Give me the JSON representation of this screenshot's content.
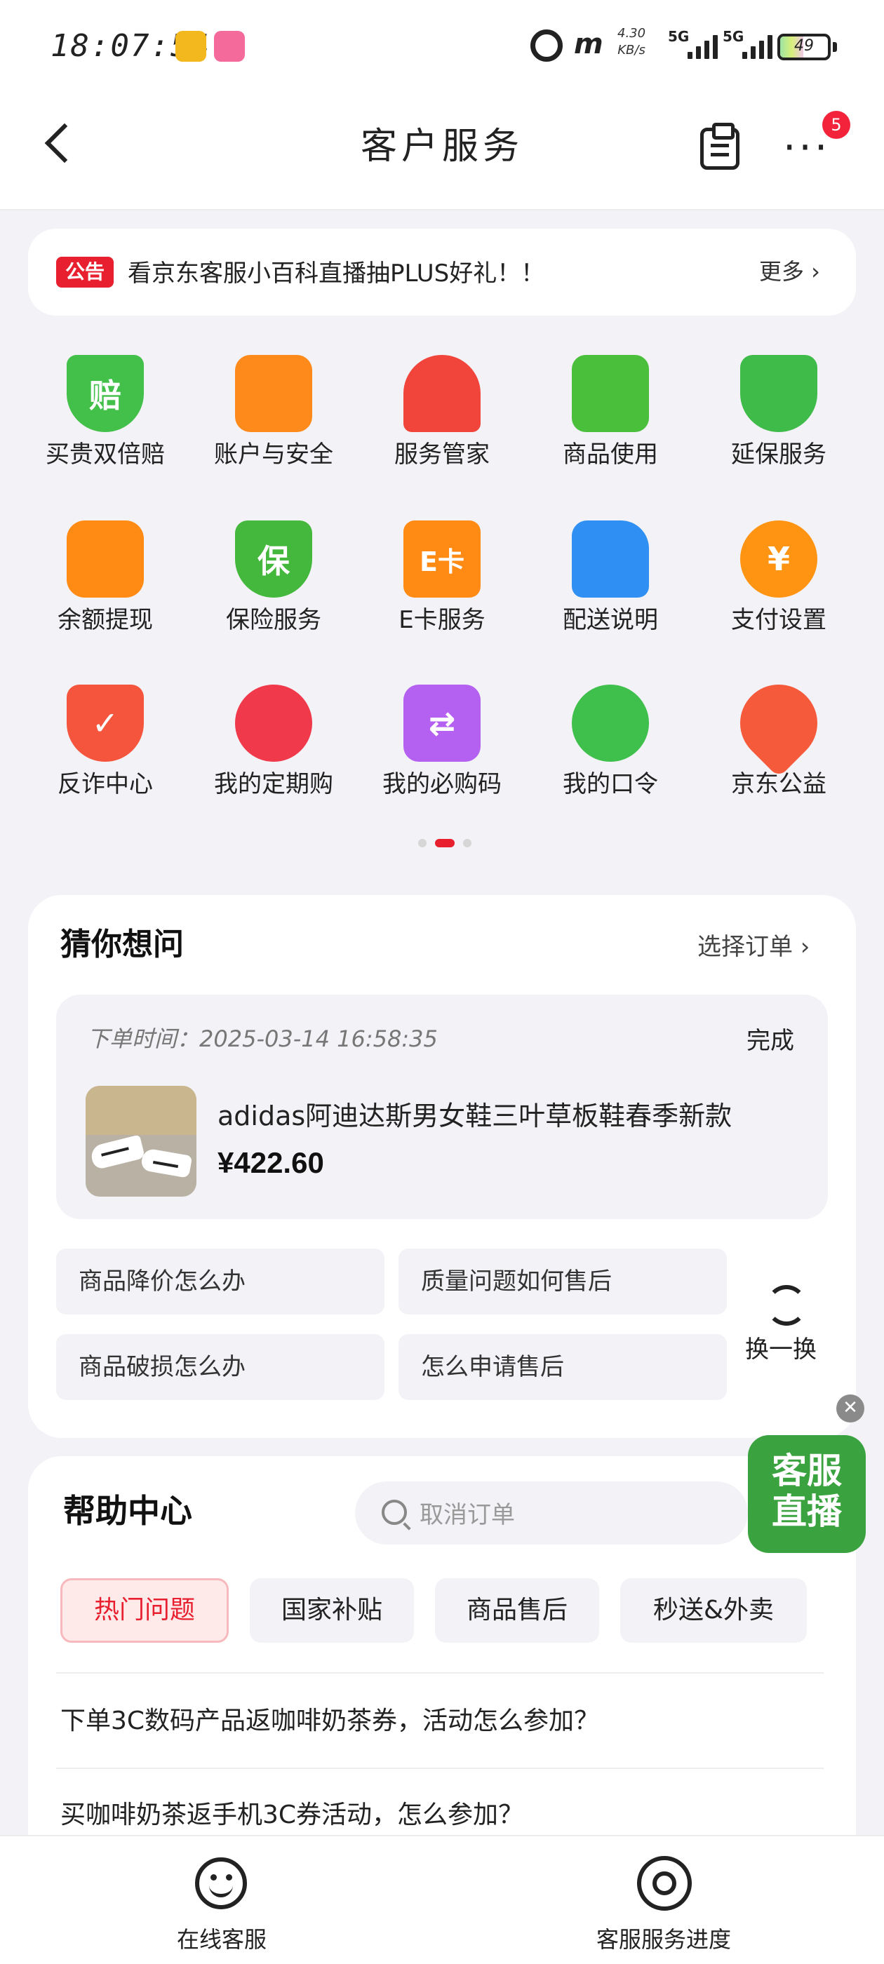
{
  "status_bar": {
    "time": "18:07:54",
    "net_speed_value": "4.30",
    "net_speed_unit": "KB/s",
    "sig1_label": "5G",
    "sig2_label": "5G",
    "battery": "49"
  },
  "header": {
    "title": "客户服务",
    "more_badge": "5"
  },
  "notice": {
    "tag": "公告",
    "text": "看京东客服小百科直播抽PLUS好礼！！",
    "more": "更多 ›"
  },
  "grid": {
    "items": [
      {
        "label": "买贵双倍赔",
        "icon": "compensation-icon",
        "glyph": "赔",
        "color": "#43c04a"
      },
      {
        "label": "账户与安全",
        "icon": "account-security-icon",
        "glyph": "",
        "color": "#ff8a1c"
      },
      {
        "label": "服务管家",
        "icon": "service-butler-icon",
        "glyph": "",
        "color": "#f1443a"
      },
      {
        "label": "商品使用",
        "icon": "product-usage-icon",
        "glyph": "",
        "color": "#49bf3c"
      },
      {
        "label": "延保服务",
        "icon": "warranty-icon",
        "glyph": "",
        "color": "#3fbb4a"
      },
      {
        "label": "余额提现",
        "icon": "wallet-icon",
        "glyph": "",
        "color": "#ff8a14"
      },
      {
        "label": "保险服务",
        "icon": "insurance-icon",
        "glyph": "保",
        "color": "#43b83c"
      },
      {
        "label": "E卡服务",
        "icon": "ecard-icon",
        "glyph": "E卡",
        "color": "#ff8a14"
      },
      {
        "label": "配送说明",
        "icon": "delivery-truck-icon",
        "glyph": "",
        "color": "#2f8ff2"
      },
      {
        "label": "支付设置",
        "icon": "payment-icon",
        "glyph": "¥",
        "color": "#ff9312"
      },
      {
        "label": "反诈中心",
        "icon": "anti-fraud-icon",
        "glyph": "✓",
        "color": "#f5553c"
      },
      {
        "label": "我的定期购",
        "icon": "alarm-clock-icon",
        "glyph": "",
        "color": "#f0394b"
      },
      {
        "label": "我的必购码",
        "icon": "coupon-code-icon",
        "glyph": "⇄",
        "color": "#b460f0"
      },
      {
        "label": "我的口令",
        "icon": "key-icon",
        "glyph": "",
        "color": "#3fbf4c"
      },
      {
        "label": "京东公益",
        "icon": "heart-icon",
        "glyph": "",
        "color": "#f55a3a"
      }
    ]
  },
  "guess": {
    "title": "猜你想问",
    "select_order": "选择订单 ›",
    "order": {
      "time_label": "下单时间：2025-03-14 16:58:35",
      "status": "完成",
      "name": "adidas阿迪达斯男女鞋三叶草板鞋春季新款",
      "price": "¥422.60"
    },
    "questions": [
      "商品降价怎么办",
      "质量问题如何售后",
      "商品破损怎么办",
      "怎么申请售后"
    ],
    "refresh": "换一换"
  },
  "live": {
    "line1": "客服",
    "line2": "直播",
    "close": "✕"
  },
  "help": {
    "title": "帮助中心",
    "search_placeholder": "取消订单",
    "tabs": [
      "热门问题",
      "国家补贴",
      "商品售后",
      "秒送&外卖"
    ],
    "faqs": [
      "下单3C数码产品返咖啡奶茶券，活动怎么参加？",
      "买咖啡奶茶返手机3C券活动，怎么参加？"
    ]
  },
  "bottom": {
    "online": "在线客服",
    "progress": "客服服务进度"
  },
  "colors": {
    "accent_red": "#e81f2f",
    "page_bg": "#f3f3f7",
    "live_green": "#3aa33f"
  }
}
